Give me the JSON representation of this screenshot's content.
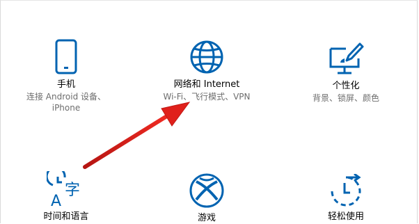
{
  "tiles": [
    {
      "title": "手机",
      "desc": "连接 Android 设备、iPhone",
      "icon": "phone-icon"
    },
    {
      "title": "网络和 Internet",
      "desc": "Wi-Fi、飞行模式、VPN",
      "icon": "globe-icon"
    },
    {
      "title": "个性化",
      "desc": "背景、锁屏、颜色",
      "icon": "personalization-icon"
    },
    {
      "title": "时间和语言",
      "desc": "",
      "icon": "time-language-icon"
    },
    {
      "title": "游戏",
      "desc": "",
      "icon": "xbox-icon"
    },
    {
      "title": "轻松使用",
      "desc": "",
      "icon": "ease-of-access-icon"
    }
  ],
  "colors": {
    "accent": "#0063b1",
    "arrow": "#e0201b",
    "desc_text": "#6d6d6d"
  }
}
